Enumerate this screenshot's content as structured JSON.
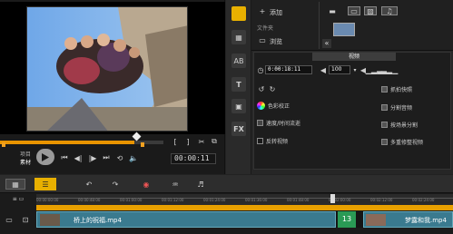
{
  "preview": {
    "timecode": "00:00:11",
    "mode_project": "项目",
    "mode_clip": "素材"
  },
  "library": {
    "add_label": "添加",
    "browse_label": "浏览",
    "folder_label": "文件夹",
    "double_arrow": "«"
  },
  "options": {
    "tab_label": "视频",
    "duration": "0:00:18:11",
    "volume": "100",
    "items": [
      {
        "label": "色彩校正"
      },
      {
        "label": "速度/时间流逝"
      },
      {
        "label": "反转视频"
      }
    ],
    "right_items": [
      {
        "label": "抓拍快照"
      },
      {
        "label": "分割音频"
      },
      {
        "label": "按场景分割"
      },
      {
        "label": "多重修整视频"
      }
    ]
  },
  "timeline": {
    "ruler_ticks": [
      "00:00:00:00",
      "00:00:48:00",
      "00:01:00:00",
      "00:01:12:00",
      "00:01:24:00",
      "00:01:36:00",
      "00:01:48:00",
      "00:02:00:00",
      "00:02:12:00",
      "00:02:24:00"
    ],
    "clips": [
      {
        "title": "桥上的祝福.mp4"
      },
      {
        "title": "梦露和我.mp4"
      }
    ],
    "clip_number": "13"
  },
  "colors": {
    "accent": "#e8a300",
    "orange": "#f0a020",
    "clip": "#3a7a8f"
  }
}
